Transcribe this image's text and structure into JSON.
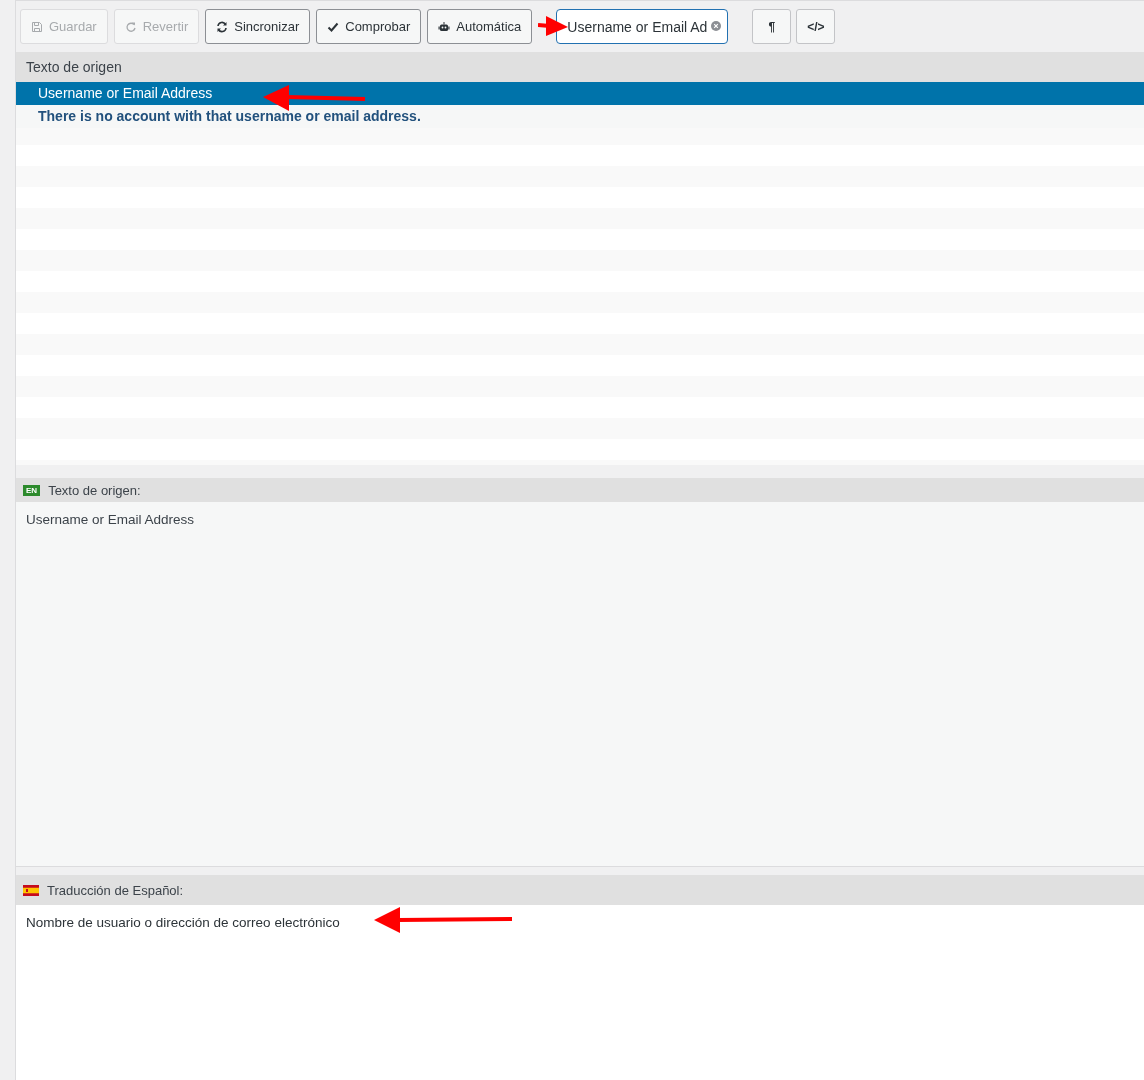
{
  "toolbar": {
    "buttons": [
      {
        "label": "Guardar",
        "disabled": true
      },
      {
        "label": "Revertir",
        "disabled": true
      },
      {
        "label": "Sincronizar",
        "disabled": false
      },
      {
        "label": "Comprobar",
        "disabled": false
      },
      {
        "label": "Automática",
        "disabled": false
      }
    ],
    "search": {
      "value": "Username or Email Ad"
    },
    "view_buttons": [
      "¶",
      "</>"
    ]
  },
  "list": {
    "header": "Texto de origen",
    "rows": [
      {
        "text": "Username or Email Address",
        "selected": true
      },
      {
        "text": "There is no account with that username or email address.",
        "selected": false
      }
    ]
  },
  "source": {
    "badge": "EN",
    "label": "Texto de origen:",
    "text": "Username or Email Address"
  },
  "translation": {
    "label": "Traducción de Español:",
    "text": "Nombre de usuario o dirección de correo electrónico"
  }
}
